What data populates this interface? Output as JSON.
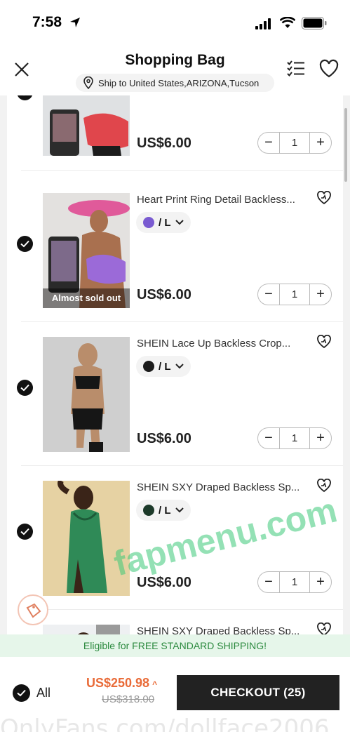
{
  "status": {
    "time": "7:58"
  },
  "header": {
    "title": "Shopping Bag",
    "ship_to": "Ship to United States,ARIZONA,Tucson"
  },
  "items": [
    {
      "title": "",
      "variant_color": "#e8405a",
      "size": "",
      "price": "US$6.00",
      "qty": "1",
      "sold_out": ""
    },
    {
      "title": "Heart Print Ring Detail Backless...",
      "variant_color": "#7a5bd1",
      "size": "/ L",
      "price": "US$6.00",
      "qty": "1",
      "sold_out": "Almost sold out"
    },
    {
      "title": "SHEIN Lace Up Backless Crop...",
      "variant_color": "#1b1b1b",
      "size": "/ L",
      "price": "US$6.00",
      "qty": "1",
      "sold_out": ""
    },
    {
      "title": "SHEIN SXY Draped Backless Sp...",
      "variant_color": "#1d3a2a",
      "size": "/ L",
      "price": "US$6.00",
      "qty": "1",
      "sold_out": ""
    },
    {
      "title": "SHEIN SXY Draped Backless Sp...",
      "variant_color": "#1d3a2a",
      "size": "",
      "price": "",
      "qty": "",
      "sold_out": ""
    }
  ],
  "banner": {
    "text": "Eligible for FREE STANDARD SHIPPING!"
  },
  "footer": {
    "all_label": "All",
    "total": "US$250.98",
    "original": "US$318.00",
    "checkout": "CHECKOUT (25)"
  },
  "watermark": "fapmenu.com",
  "bottom_strip": "OnlyFans.com/dollface2006",
  "colors": {
    "accent": "#e96b38",
    "banner_bg": "#e6f6ea",
    "banner_text": "#2c8a3f"
  }
}
